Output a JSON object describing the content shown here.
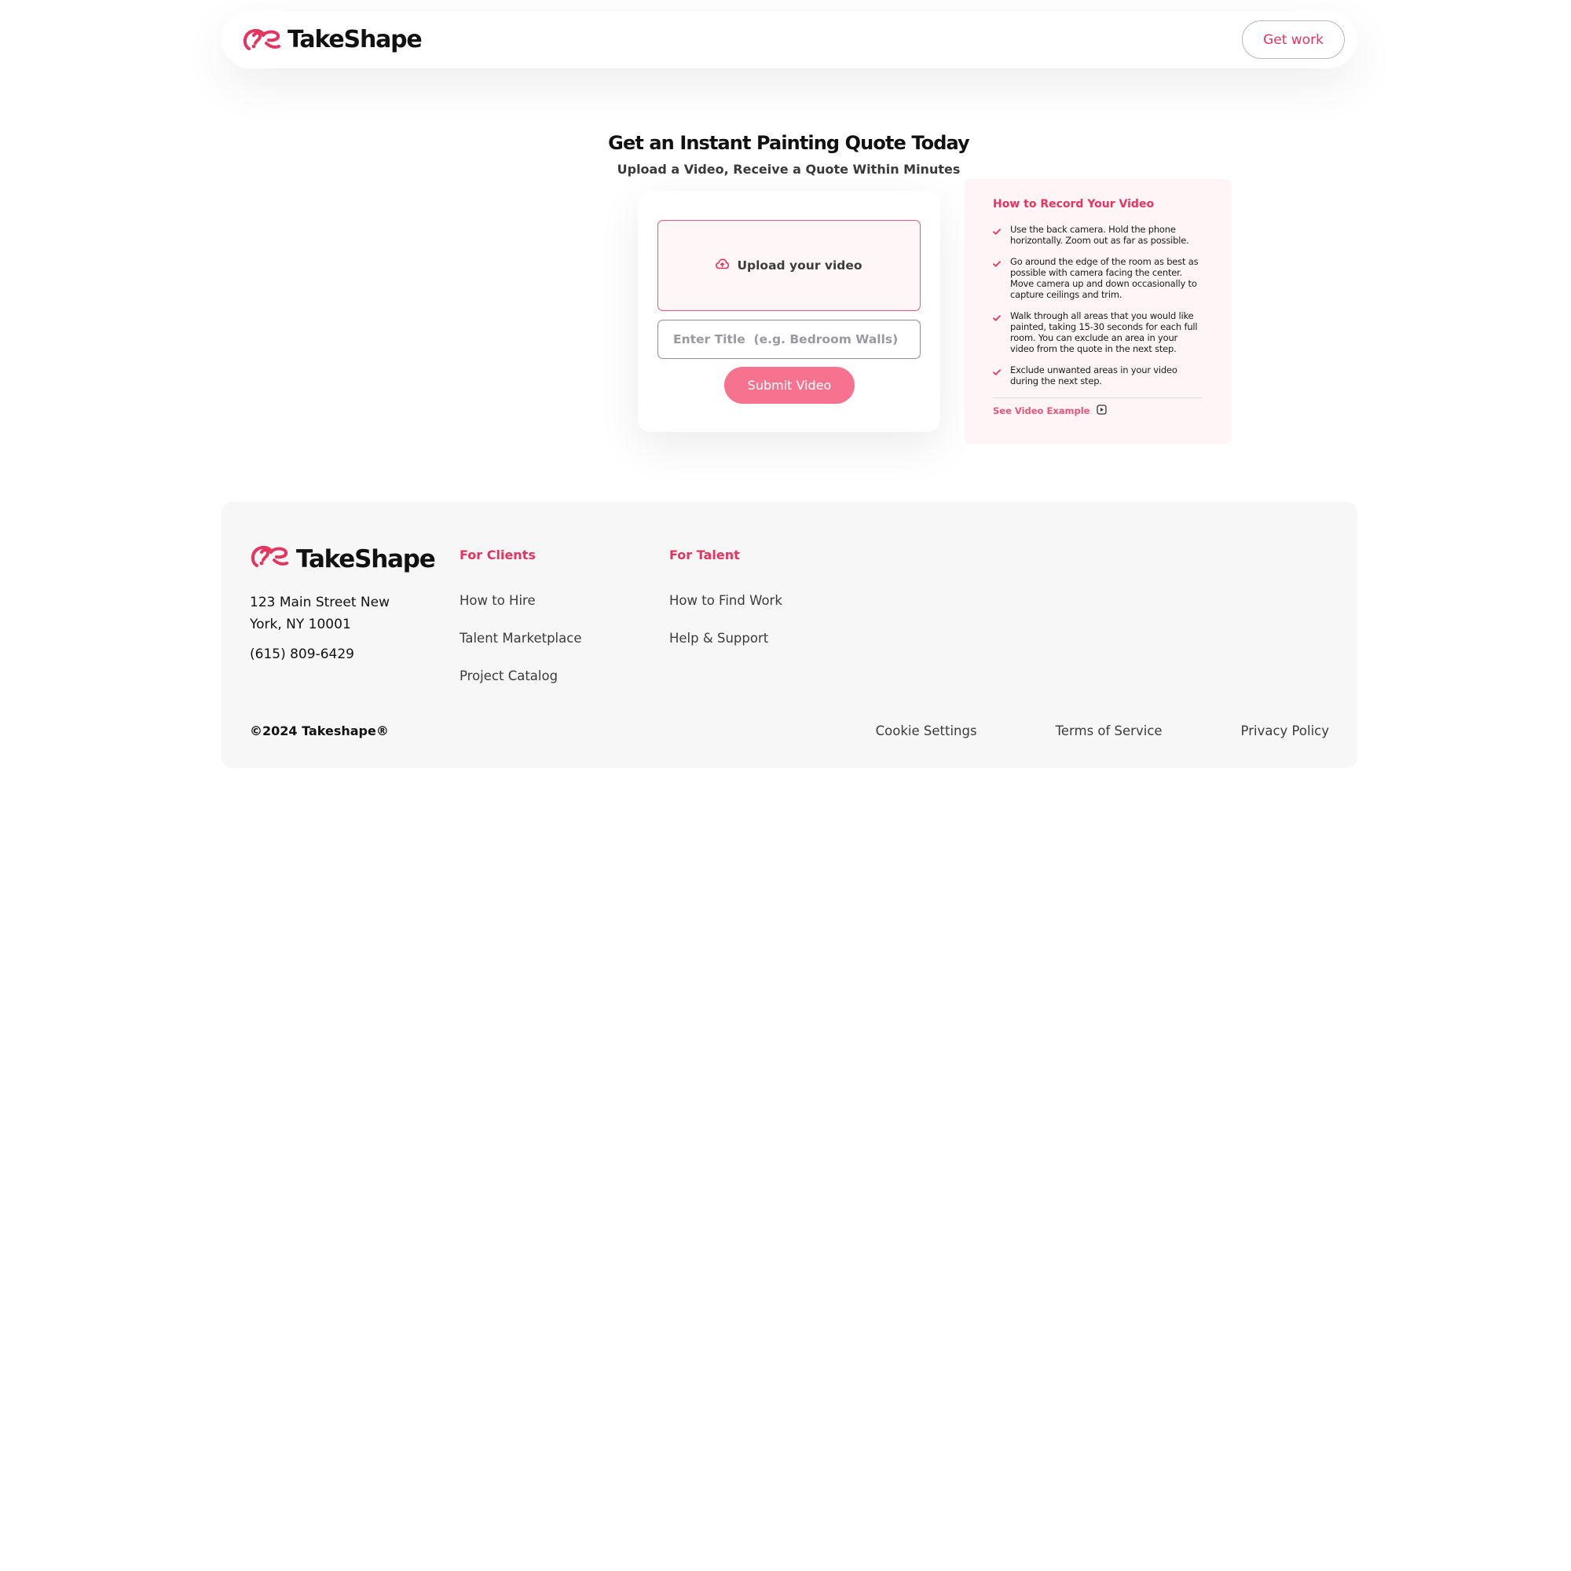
{
  "header": {
    "brand_name": "TakeShape",
    "get_work_label": "Get work"
  },
  "hero": {
    "title": "Get an Instant Painting Quote Today",
    "subtitle": "Upload a Video, Receive a Quote Within Minutes"
  },
  "upload_card": {
    "upload_label": "Upload your video",
    "title_placeholder": "Enter Title  (e.g. Bedroom Walls)",
    "submit_label": "Submit Video"
  },
  "instructions": {
    "title": "How to Record Your Video",
    "items": [
      "Use the back camera. Hold the phone horizontally. Zoom out as far as possible.",
      "Go around the edge of the room as best as possible with camera facing the center. Move camera up and down occasionally to capture ceilings and trim.",
      "Walk through all areas that you would like painted, taking 15-30 seconds for each full room. You can exclude an area in your video from the quote in the next step.",
      "Exclude unwanted areas in your video during the next step."
    ],
    "video_example_label": "See Video Example"
  },
  "footer": {
    "brand_name": "TakeShape",
    "address": "123 Main Street New York, NY 10001",
    "phone": "(615) 809-6429",
    "clients": {
      "title": "For Clients",
      "links": [
        "How to Hire",
        "Talent Marketplace",
        "Project Catalog"
      ]
    },
    "talent": {
      "title": "For Talent",
      "links": [
        "How to Find Work",
        "Help & Support"
      ]
    },
    "copyright": "©2024 Takeshape®",
    "legal": [
      "Cookie Settings",
      "Terms of Service",
      "Privacy Policy"
    ]
  },
  "colors": {
    "brand_pink": "#e4355f",
    "submit_pink": "#f7728f",
    "panel_bg": "#fff5f6",
    "footer_bg": "#f7f7f7"
  },
  "icons": {
    "logo": "takeshape-logo-icon",
    "upload": "cloud-upload-icon",
    "check": "check-icon",
    "video_example": "play-square-icon"
  }
}
